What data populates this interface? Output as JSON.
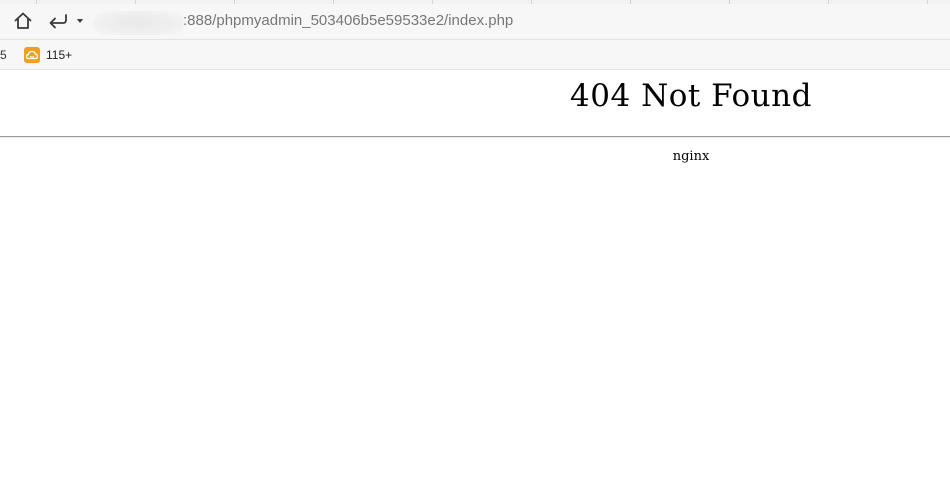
{
  "browser": {
    "address_bar": {
      "url_visible": ":888/phpmyadmin_503406b5e59533e2/index.php"
    },
    "nav": {
      "home_icon": "home-icon",
      "back_icon": "back-arrow-icon",
      "dropdown_icon": "dropdown-arrow-icon"
    },
    "bookmarks": {
      "fragment_label": "5",
      "items": [
        {
          "label": "115+",
          "icon": "cloud-icon",
          "color": "#f0a020"
        }
      ]
    }
  },
  "page": {
    "title": "404 Not Found",
    "server": "nginx"
  }
}
